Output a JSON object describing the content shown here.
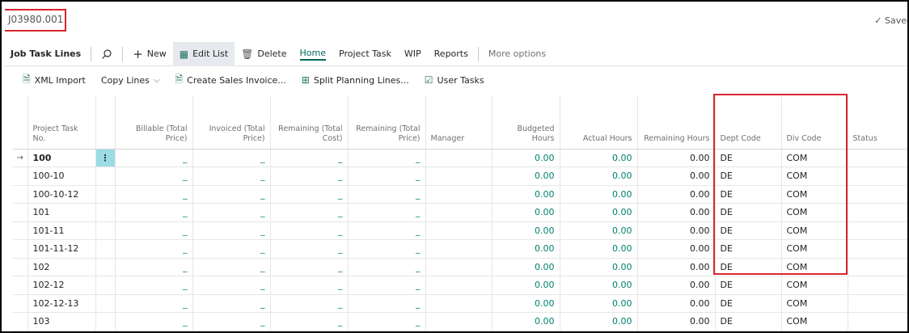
{
  "header": {
    "record_no": "J03980.001",
    "save_status": "✓ Saved"
  },
  "actionbar": {
    "section_title": "Job Task Lines",
    "new_label": "New",
    "edit_list_label": "Edit List",
    "delete_label": "Delete",
    "tabs": [
      "Home",
      "Project Task",
      "WIP",
      "Reports"
    ],
    "more_label": "More options"
  },
  "subbar": {
    "xml_import": "XML Import",
    "copy_lines": "Copy Lines",
    "create_sales_invoice": "Create Sales Invoice...",
    "split_planning_lines": "Split Planning Lines...",
    "user_tasks": "User Tasks"
  },
  "table": {
    "columns": [
      "Project Task No.",
      "Billable (Total Price)",
      "Invoiced (Total Price)",
      "Remaining (Total Cost)",
      "Remaining (Total Price)",
      "Manager",
      "Budgeted Hours",
      "Actual Hours",
      "Remaining Hours",
      "Dept Code",
      "Div Code",
      "Status"
    ],
    "rows": [
      {
        "task": "100",
        "billable": "_",
        "invoiced": "_",
        "rem_cost": "_",
        "rem_price": "_",
        "manager": "",
        "budgeted": "0.00",
        "actual": "0.00",
        "remaining": "0.00",
        "dept": "DE",
        "div": "COM",
        "status": ""
      },
      {
        "task": "100-10",
        "billable": "_",
        "invoiced": "_",
        "rem_cost": "_",
        "rem_price": "_",
        "manager": "",
        "budgeted": "0.00",
        "actual": "0.00",
        "remaining": "0.00",
        "dept": "DE",
        "div": "COM",
        "status": ""
      },
      {
        "task": "100-10-12",
        "billable": "_",
        "invoiced": "_",
        "rem_cost": "_",
        "rem_price": "_",
        "manager": "",
        "budgeted": "0.00",
        "actual": "0.00",
        "remaining": "0.00",
        "dept": "DE",
        "div": "COM",
        "status": ""
      },
      {
        "task": "101",
        "billable": "_",
        "invoiced": "_",
        "rem_cost": "_",
        "rem_price": "_",
        "manager": "",
        "budgeted": "0.00",
        "actual": "0.00",
        "remaining": "0.00",
        "dept": "DE",
        "div": "COM",
        "status": ""
      },
      {
        "task": "101-11",
        "billable": "_",
        "invoiced": "_",
        "rem_cost": "_",
        "rem_price": "_",
        "manager": "",
        "budgeted": "0.00",
        "actual": "0.00",
        "remaining": "0.00",
        "dept": "DE",
        "div": "COM",
        "status": ""
      },
      {
        "task": "101-11-12",
        "billable": "_",
        "invoiced": "_",
        "rem_cost": "_",
        "rem_price": "_",
        "manager": "",
        "budgeted": "0.00",
        "actual": "0.00",
        "remaining": "0.00",
        "dept": "DE",
        "div": "COM",
        "status": ""
      },
      {
        "task": "102",
        "billable": "_",
        "invoiced": "_",
        "rem_cost": "_",
        "rem_price": "_",
        "manager": "",
        "budgeted": "0.00",
        "actual": "0.00",
        "remaining": "0.00",
        "dept": "DE",
        "div": "COM",
        "status": ""
      },
      {
        "task": "102-12",
        "billable": "_",
        "invoiced": "_",
        "rem_cost": "_",
        "rem_price": "_",
        "manager": "",
        "budgeted": "0.00",
        "actual": "0.00",
        "remaining": "0.00",
        "dept": "DE",
        "div": "COM",
        "status": ""
      },
      {
        "task": "102-12-13",
        "billable": "_",
        "invoiced": "_",
        "rem_cost": "_",
        "rem_price": "_",
        "manager": "",
        "budgeted": "0.00",
        "actual": "0.00",
        "remaining": "0.00",
        "dept": "DE",
        "div": "COM",
        "status": ""
      },
      {
        "task": "103",
        "billable": "_",
        "invoiced": "_",
        "rem_cost": "_",
        "rem_price": "_",
        "manager": "",
        "budgeted": "0.00",
        "actual": "0.00",
        "remaining": "0.00",
        "dept": "DE",
        "div": "COM",
        "status": ""
      }
    ]
  },
  "colors": {
    "accent": "#00675b",
    "highlight_box": "#d8262e",
    "selected_cell": "#9bdce4"
  },
  "icons": [
    "search-icon",
    "plus-icon",
    "edit-list-icon",
    "trash-icon",
    "xml-icon",
    "chevron-down-icon",
    "invoice-icon",
    "split-icon",
    "task-icon",
    "row-pointer-icon",
    "ellipsis-icon"
  ]
}
